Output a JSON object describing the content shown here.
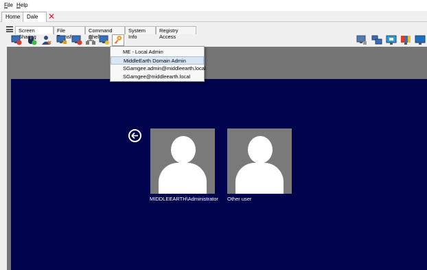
{
  "menu": {
    "file": "File",
    "help": "Help"
  },
  "host_tabs": [
    {
      "label": "Home"
    },
    {
      "label": "Dale"
    }
  ],
  "function_tabs": [
    {
      "label": "Screen Sharing"
    },
    {
      "label": "File Transfer"
    },
    {
      "label": "Command Shell"
    },
    {
      "label": "System Info"
    },
    {
      "label": "Registry Access"
    }
  ],
  "credentials_menu": [
    {
      "label": "ME - Local Admin"
    },
    {
      "label": "MiddleEarth Domain Admin"
    },
    {
      "label": "SGamgee.admin@middleearth.local"
    },
    {
      "label": "SGamgee@middleearth.local"
    }
  ],
  "remote_screen": {
    "users": [
      {
        "label": "MIDDLEEARTH\\Administrator"
      },
      {
        "label": "Other user"
      }
    ]
  },
  "colors": {
    "remote_bg": "#02034d",
    "viewport_bg": "#757575",
    "close_red": "#e81123"
  },
  "icons": {
    "toolbar_left": [
      "monitor-icon",
      "mouse-lock-icon",
      "user-icon",
      "monitor-settings-icon",
      "monitor-block-icon",
      "network-icon",
      "monitor-refresh-icon",
      "key-icon"
    ],
    "toolbar_right": [
      "monitor-icon",
      "multi-monitor-icon",
      "screen-icon",
      "colors-icon",
      "monitor-cyan-icon"
    ]
  }
}
